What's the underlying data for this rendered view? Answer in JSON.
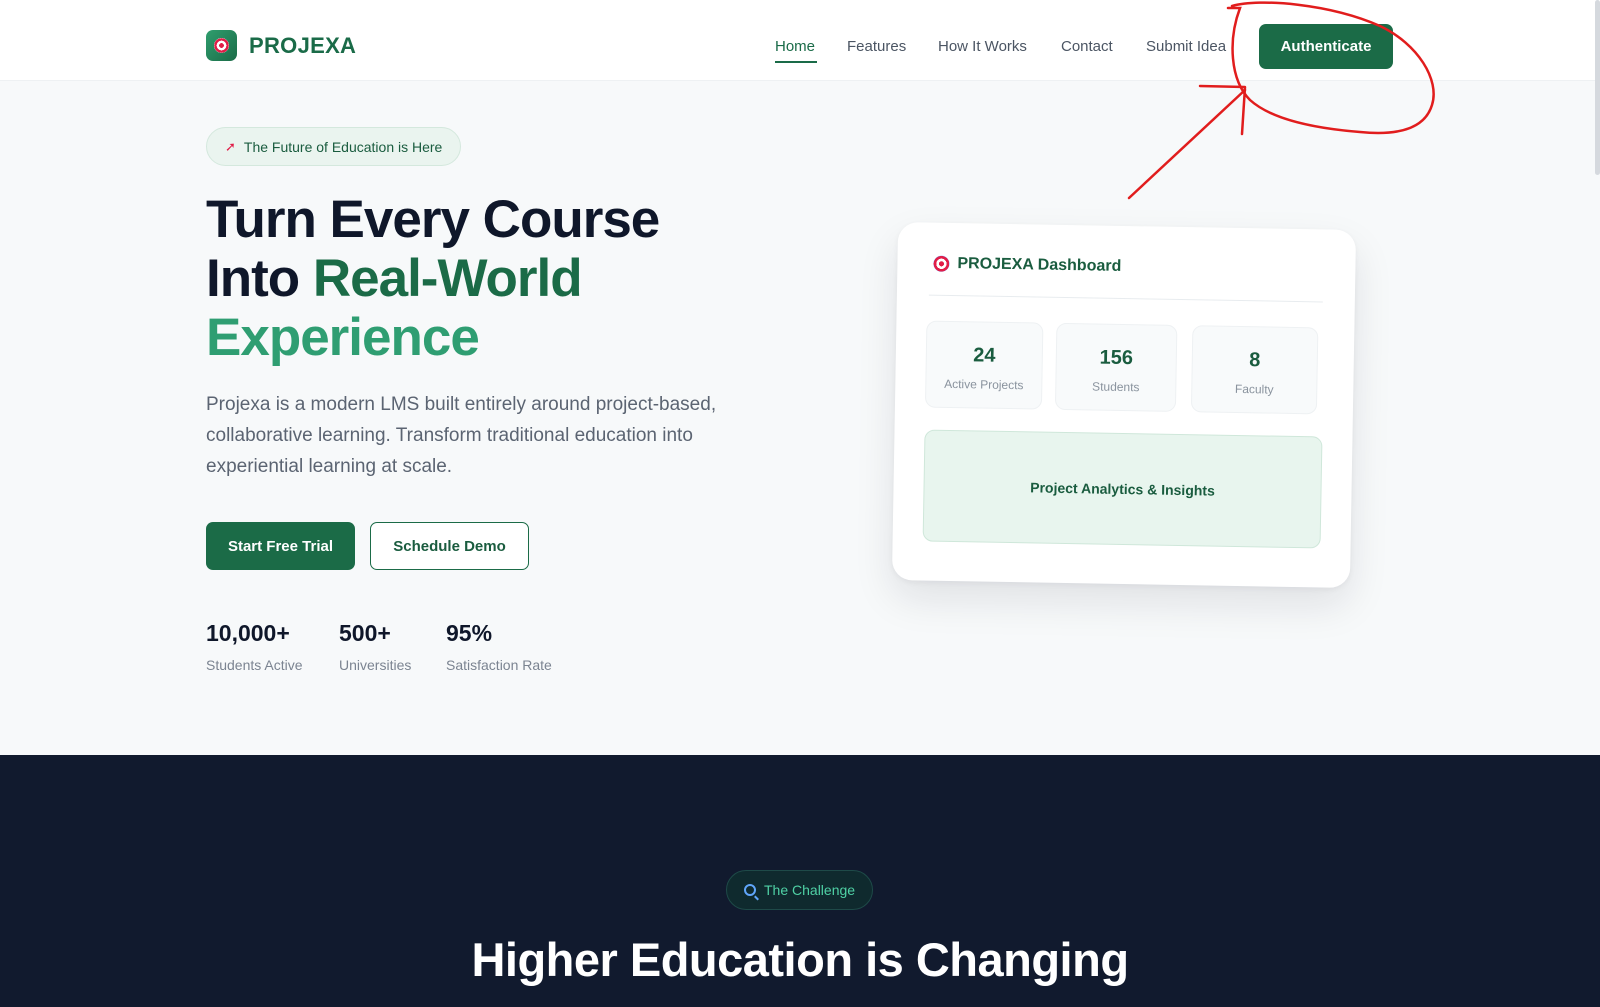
{
  "brand": {
    "name": "PROJEXA",
    "icon": "target-icon"
  },
  "nav": {
    "links": [
      "Home",
      "Features",
      "How It Works",
      "Contact",
      "Submit Idea"
    ],
    "active": "Home",
    "cta": "Authenticate"
  },
  "hero": {
    "badge_icon": "rocket-icon",
    "badge": "The Future of Education is Here",
    "title_line1": "Turn Every Course",
    "title_line2_a": "Into ",
    "title_line2_b": "Real-World",
    "title_line3": "Experience",
    "description": "Projexa is a modern LMS built entirely around project-based, collaborative learning. Transform traditional education into experiential learning at scale.",
    "primary_button": "Start Free Trial",
    "secondary_button": "Schedule Demo",
    "stats": [
      {
        "value": "10,000+",
        "label": "Students Active"
      },
      {
        "value": "500+",
        "label": "Universities"
      },
      {
        "value": "95%",
        "label": "Satisfaction Rate"
      }
    ]
  },
  "dashboard": {
    "title": "PROJEXA Dashboard",
    "stats": [
      {
        "value": "24",
        "label": "Active Projects"
      },
      {
        "value": "156",
        "label": "Students"
      },
      {
        "value": "8",
        "label": "Faculty"
      }
    ],
    "analytics": "Project Analytics & Insights"
  },
  "challenge": {
    "badge_icon": "magnifier-icon",
    "badge": "The Challenge",
    "title": "Higher Education is Changing"
  },
  "annotation": {
    "color": "#e11d1d"
  },
  "colors": {
    "brand_green": "#1b6b47",
    "accent_green": "#2f9e72",
    "dark_bg": "#111a2e"
  }
}
